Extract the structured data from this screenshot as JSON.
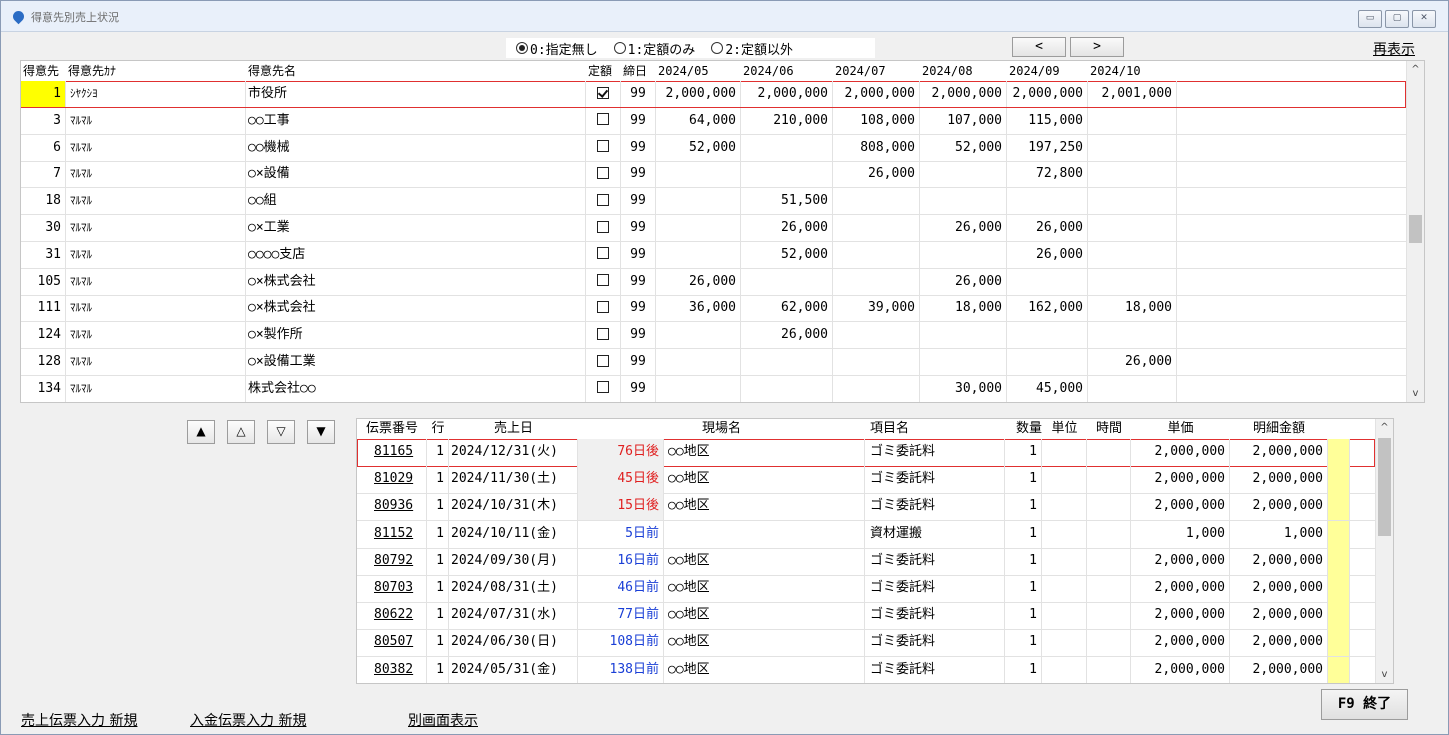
{
  "window": {
    "title": "得意先別売上状況",
    "buttons": [
      "▭",
      "▢",
      "✕"
    ]
  },
  "filter": {
    "options": [
      "0:指定無し",
      "1:定額のみ",
      "2:定額以外"
    ],
    "selected": 0
  },
  "nav": {
    "prev": "<",
    "next": ">"
  },
  "refresh_label": "再表示",
  "customers": {
    "headers": [
      "得意先",
      "得意先ｶﾅ",
      "得意先名",
      "定額",
      "締日",
      "2024/05",
      "2024/06",
      "2024/07",
      "2024/08",
      "2024/09",
      "2024/10"
    ],
    "rows": [
      {
        "code": "1",
        "kana": "ｼﾔｸｼﾖ",
        "name": "市役所",
        "fixed": true,
        "close": "99",
        "m": [
          "2,000,000",
          "2,000,000",
          "2,000,000",
          "2,000,000",
          "2,000,000",
          "2,001,000"
        ]
      },
      {
        "code": "3",
        "kana": "ﾏﾙﾏﾙ",
        "name": "○○工事",
        "fixed": false,
        "close": "99",
        "m": [
          "64,000",
          "210,000",
          "108,000",
          "107,000",
          "115,000",
          ""
        ]
      },
      {
        "code": "6",
        "kana": "ﾏﾙﾏﾙ",
        "name": "○○機械",
        "fixed": false,
        "close": "99",
        "m": [
          "52,000",
          "",
          "808,000",
          "52,000",
          "197,250",
          ""
        ]
      },
      {
        "code": "7",
        "kana": "ﾏﾙﾏﾙ",
        "name": "○×設備",
        "fixed": false,
        "close": "99",
        "m": [
          "",
          "",
          "26,000",
          "",
          "72,800",
          ""
        ]
      },
      {
        "code": "18",
        "kana": "ﾏﾙﾏﾙ",
        "name": "○○組",
        "fixed": false,
        "close": "99",
        "m": [
          "",
          "51,500",
          "",
          "",
          "",
          ""
        ]
      },
      {
        "code": "30",
        "kana": "ﾏﾙﾏﾙ",
        "name": "○×工業",
        "fixed": false,
        "close": "99",
        "m": [
          "",
          "26,000",
          "",
          "26,000",
          "26,000",
          ""
        ]
      },
      {
        "code": "31",
        "kana": "ﾏﾙﾏﾙ",
        "name": "○○○○支店",
        "fixed": false,
        "close": "99",
        "m": [
          "",
          "52,000",
          "",
          "",
          "26,000",
          ""
        ]
      },
      {
        "code": "105",
        "kana": "ﾏﾙﾏﾙ",
        "name": "○×株式会社",
        "fixed": false,
        "close": "99",
        "m": [
          "26,000",
          "",
          "",
          "26,000",
          "",
          ""
        ]
      },
      {
        "code": "111",
        "kana": "ﾏﾙﾏﾙ",
        "name": "○×株式会社",
        "fixed": false,
        "close": "99",
        "m": [
          "36,000",
          "62,000",
          "39,000",
          "18,000",
          "162,000",
          "18,000"
        ]
      },
      {
        "code": "124",
        "kana": "ﾏﾙﾏﾙ",
        "name": "○×製作所",
        "fixed": false,
        "close": "99",
        "m": [
          "",
          "26,000",
          "",
          "",
          "",
          ""
        ]
      },
      {
        "code": "128",
        "kana": "ﾏﾙﾏﾙ",
        "name": "○×設備工業",
        "fixed": false,
        "close": "99",
        "m": [
          "",
          "",
          "",
          "",
          "",
          "26,000"
        ]
      },
      {
        "code": "134",
        "kana": "ﾏﾙﾏﾙ",
        "name": "株式会社○○",
        "fixed": false,
        "close": "99",
        "m": [
          "",
          "",
          "",
          "30,000",
          "45,000",
          ""
        ]
      }
    ]
  },
  "row_buttons": [
    "▲",
    "△",
    "▽",
    "▼"
  ],
  "slips": {
    "headers": [
      "伝票番号",
      "行",
      "売上日",
      "現場名",
      "項目名",
      "数量",
      "単位",
      "時間",
      "単価",
      "明細金額"
    ],
    "rows": [
      {
        "no": "81165",
        "line": "1",
        "date": "2024/12/31(火)",
        "rel": "76日後",
        "past": false,
        "site": "○○地区",
        "item": "ゴミ委託料",
        "qty": "1",
        "unit": "",
        "time": "",
        "price": "2,000,000",
        "amount": "2,000,000"
      },
      {
        "no": "81029",
        "line": "1",
        "date": "2024/11/30(土)",
        "rel": "45日後",
        "past": false,
        "site": "○○地区",
        "item": "ゴミ委託料",
        "qty": "1",
        "unit": "",
        "time": "",
        "price": "2,000,000",
        "amount": "2,000,000"
      },
      {
        "no": "80936",
        "line": "1",
        "date": "2024/10/31(木)",
        "rel": "15日後",
        "past": false,
        "site": "○○地区",
        "item": "ゴミ委託料",
        "qty": "1",
        "unit": "",
        "time": "",
        "price": "2,000,000",
        "amount": "2,000,000"
      },
      {
        "no": "81152",
        "line": "1",
        "date": "2024/10/11(金)",
        "rel": "5日前",
        "past": true,
        "site": "",
        "item": "資材運搬",
        "qty": "1",
        "unit": "",
        "time": "",
        "price": "1,000",
        "amount": "1,000"
      },
      {
        "no": "80792",
        "line": "1",
        "date": "2024/09/30(月)",
        "rel": "16日前",
        "past": true,
        "site": "○○地区",
        "item": "ゴミ委託料",
        "qty": "1",
        "unit": "",
        "time": "",
        "price": "2,000,000",
        "amount": "2,000,000"
      },
      {
        "no": "80703",
        "line": "1",
        "date": "2024/08/31(土)",
        "rel": "46日前",
        "past": true,
        "site": "○○地区",
        "item": "ゴミ委託料",
        "qty": "1",
        "unit": "",
        "time": "",
        "price": "2,000,000",
        "amount": "2,000,000"
      },
      {
        "no": "80622",
        "line": "1",
        "date": "2024/07/31(水)",
        "rel": "77日前",
        "past": true,
        "site": "○○地区",
        "item": "ゴミ委託料",
        "qty": "1",
        "unit": "",
        "time": "",
        "price": "2,000,000",
        "amount": "2,000,000"
      },
      {
        "no": "80507",
        "line": "1",
        "date": "2024/06/30(日)",
        "rel": "108日前",
        "past": true,
        "site": "○○地区",
        "item": "ゴミ委託料",
        "qty": "1",
        "unit": "",
        "time": "",
        "price": "2,000,000",
        "amount": "2,000,000"
      },
      {
        "no": "80382",
        "line": "1",
        "date": "2024/05/31(金)",
        "rel": "138日前",
        "past": true,
        "site": "○○地区",
        "item": "ゴミ委託料",
        "qty": "1",
        "unit": "",
        "time": "",
        "price": "2,000,000",
        "amount": "2,000,000"
      }
    ]
  },
  "footer": {
    "links": [
      "売上伝票入力 新規",
      "入金伝票入力 新規",
      "別画面表示"
    ],
    "exit_label": "F9 終了"
  },
  "scroll": {
    "arrow_up": "^",
    "arrow_down": "v"
  },
  "colors": {
    "selection_border": "#e03030",
    "highlight": "#ffff00",
    "future_date": "#e02020",
    "past_date": "#1a3fd6",
    "amount_marker": "#ffff99"
  }
}
